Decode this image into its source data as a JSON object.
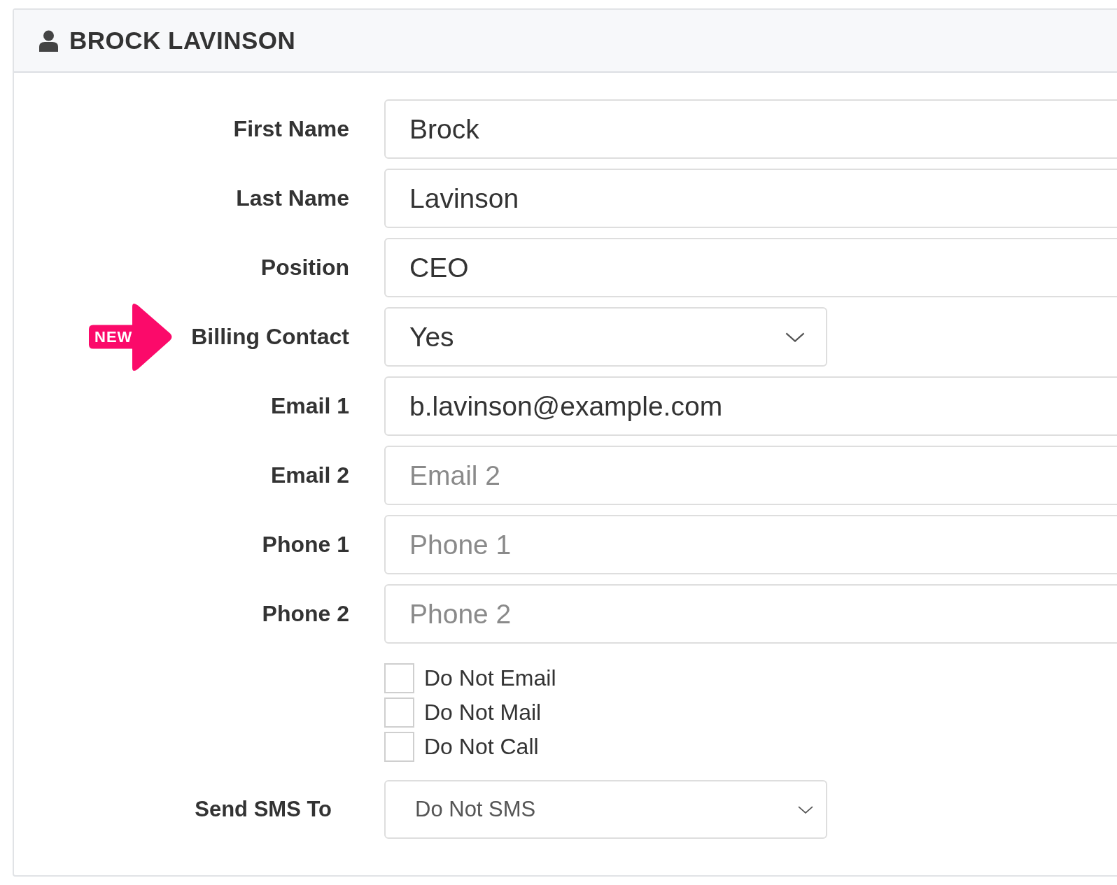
{
  "title": "BROCK LAVINSON",
  "fields": [
    {
      "label": "First Name",
      "kind": "text",
      "value": "Brock"
    },
    {
      "label": "Last Name",
      "kind": "text",
      "value": "Lavinson"
    },
    {
      "label": "Position",
      "kind": "text",
      "value": "CEO"
    },
    {
      "label": "Billing Contact",
      "kind": "select",
      "value": "Yes",
      "badge": "NEW"
    },
    {
      "label": "Email 1",
      "kind": "text",
      "value": "b.lavinson@example.com"
    },
    {
      "label": "Email 2",
      "kind": "text",
      "placeholder": "Email 2"
    },
    {
      "label": "Phone 1",
      "kind": "text",
      "placeholder": "Phone 1"
    },
    {
      "label": "Phone 2",
      "kind": "text",
      "placeholder": "Phone 2"
    }
  ],
  "checkboxes": [
    {
      "label": "Do Not Email",
      "checked": false
    },
    {
      "label": "Do Not Mail",
      "checked": false
    },
    {
      "label": "Do Not Call",
      "checked": false
    }
  ],
  "sms": {
    "label": "Send SMS To",
    "value": "Do Not SMS"
  }
}
